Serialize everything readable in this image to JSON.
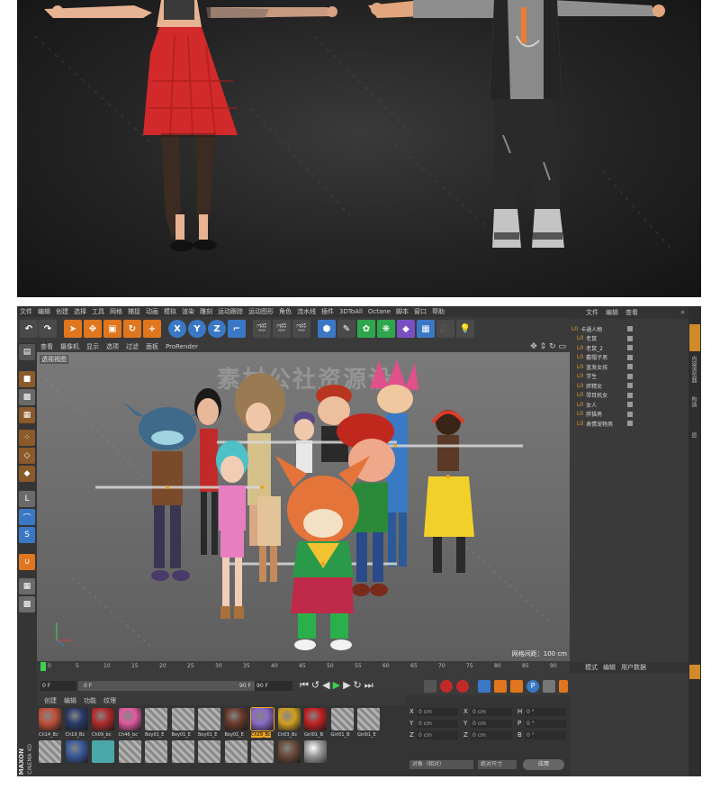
{
  "menu_items": [
    "文件",
    "编辑",
    "创建",
    "选择",
    "工具",
    "网格",
    "捕捉",
    "动画",
    "模拟",
    "渲染",
    "雕刻",
    "运动跟踪",
    "运动图形",
    "角色",
    "流水线",
    "插件",
    "3DToAll",
    "Octane",
    "脚本",
    "窗口",
    "帮助"
  ],
  "viewport_menu": [
    "查看",
    "摄像机",
    "显示",
    "选项",
    "过滤",
    "面板",
    "ProRender"
  ],
  "viewport": {
    "label": "透视视图",
    "grid_spacing": "网格间距：100 cm"
  },
  "object_panel": {
    "menu": [
      "文件",
      "编辑",
      "查看"
    ],
    "objects": [
      "卡通人物",
      "老鼠",
      "老鼠_2",
      "戴帽子男",
      "蓝发女孩",
      "学生",
      "胖精女",
      "带耳机女",
      "女人",
      "胖猫男",
      "表情宠物男"
    ]
  },
  "right_tabs": [
    "对象",
    "内容浏览器",
    "构造",
    "层"
  ],
  "timeline": {
    "ticks": [
      "0",
      "5",
      "10",
      "15",
      "20",
      "25",
      "30",
      "35",
      "40",
      "45",
      "50",
      "55",
      "60",
      "65",
      "70",
      "75",
      "80",
      "85",
      "90"
    ],
    "frame_field": "0 F",
    "start_field": "0 F",
    "end_field": "90 F",
    "end_field2": "90 F",
    "current_frame": "0 F"
  },
  "material_panel": {
    "menu": [
      "创建",
      "编辑",
      "功能",
      "纹理"
    ],
    "materials": [
      "Ch14_Bc",
      "Ch19_Bc",
      "Ch09_bc",
      "Ch46_bc",
      "Boy01_E",
      "Boy01_E",
      "Boy01_E",
      "Boy01_E",
      "Ch29_Bc",
      "Ch03_Bc",
      "Girl01_B",
      "Girl01_B",
      "Girl01_E"
    ]
  },
  "coord_panel": {
    "labels": [
      "X",
      "Y",
      "Z",
      "X",
      "Y",
      "Z",
      "H",
      "P",
      "B"
    ],
    "values": [
      "0 cm",
      "0 cm",
      "0 cm",
      "0 cm",
      "0 cm",
      "0 cm",
      "0 °",
      "0 °",
      "0 °"
    ],
    "mode": "对象（相对）",
    "size_mode": "绝对尺寸",
    "apply": "应用"
  },
  "attr_panel": {
    "menu": [
      "模式",
      "编辑",
      "用户数据"
    ]
  },
  "brand": {
    "maxon": "MAXON",
    "cinema": "CINEMA 4D"
  },
  "watermark": "素材公社资源设",
  "colors": {
    "accent": "#e0761e",
    "selected_material": "#f0a81c",
    "blue_tool": "#3a78c6"
  }
}
